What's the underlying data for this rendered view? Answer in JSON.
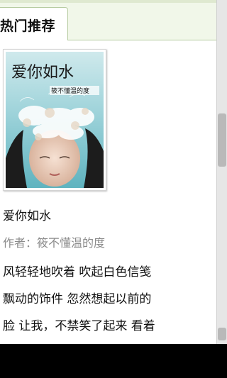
{
  "tabs": {
    "active_label": "热门推荐"
  },
  "book": {
    "cover_title": "爱你如水",
    "cover_subtitle": "筱不懂温的度",
    "title": "爱你如水",
    "author": "作者：筱不懂温的度",
    "description_lines": [
      "风轻轻地吹着 吹起白色信笺",
      "飘动的饰件 忽然想起以前的",
      "脸 让我，不禁笑了起来 看着"
    ]
  },
  "colors": {
    "tab_bar_bg": "#f1f7e9",
    "tab_border": "#b6cba0",
    "author_gray": "#8a8a8a"
  },
  "icons": {
    "scrollbar": "vertical-scrollbar"
  }
}
